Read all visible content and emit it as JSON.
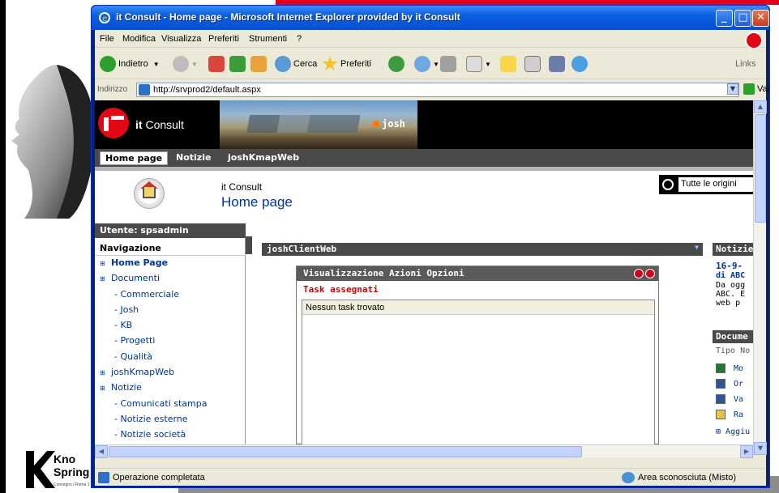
{
  "window": {
    "title": "it Consult - Home page - Microsoft Internet Explorer provided by it Consult",
    "controls": {
      "minimize": "_",
      "maximize": "□",
      "close": "✕"
    }
  },
  "menubar": [
    "File",
    "Modifica",
    "Visualizza",
    "Preferiti",
    "Strumenti",
    "?"
  ],
  "toolbar": {
    "back": "Indietro",
    "search": "Cerca",
    "favorites": "Preferiti",
    "links": "Links"
  },
  "address": {
    "label": "Indirizzo",
    "url": "http://srvprod2/default.aspx",
    "go": "Vai"
  },
  "site": {
    "brand_it": "it",
    "brand_rest": " Consult",
    "banner_label": "josh",
    "nav": [
      "Home page",
      "Notizie",
      "joshKmapWeb"
    ],
    "org": "it Consult",
    "title": "Home page",
    "search_value": "Tutte le origini"
  },
  "left": {
    "user": "Utente: spsadmin",
    "nav_title": "Navigazione",
    "items": [
      {
        "label": "Home Page",
        "level": 0,
        "bold": true
      },
      {
        "label": "Documenti",
        "level": 0
      },
      {
        "label": "- Commerciale",
        "level": 1
      },
      {
        "label": "- Josh",
        "level": 1
      },
      {
        "label": "- KB",
        "level": 1
      },
      {
        "label": "- Progetti",
        "level": 1
      },
      {
        "label": "- Qualità",
        "level": 1
      },
      {
        "label": "joshKmapWeb",
        "level": 0
      },
      {
        "label": "Notizie",
        "level": 0
      },
      {
        "label": "- Comunicati stampa",
        "level": 1
      },
      {
        "label": "- Notizie esterne",
        "level": 1
      },
      {
        "label": "- Notizie società",
        "level": 1
      }
    ]
  },
  "center": {
    "webpart_title": "joshClientWeb",
    "task_menu": "Visualizzazione  Azioni  Opzioni",
    "task_title": "Task assegnati",
    "task_empty": "Nessun task trovato"
  },
  "right": {
    "news_head": "Notizie",
    "news_date": "16-9-",
    "news_title": "di ABC",
    "news_lines": [
      "Da ogg",
      "ABC. E",
      "web p"
    ],
    "docs_head": "Docume",
    "docs_cols": "Tipo No",
    "docs": [
      {
        "name": "Mo",
        "icon": "excel-icon",
        "color": "#1d7a2f"
      },
      {
        "name": "Or",
        "icon": "word-icon",
        "color": "#2b5797"
      },
      {
        "name": "Va",
        "icon": "word-icon",
        "color": "#2b5797"
      },
      {
        "name": "Ra",
        "icon": "folder-icon",
        "color": "#e8c24a"
      }
    ],
    "add_link": "Aggiu"
  },
  "status": {
    "left": "Operazione completata",
    "zone": "Area sconosciuta (Misto)"
  },
  "slide": {
    "logo_line1": "Kno",
    "logo_line2": "Spring 2006",
    "logo_small": "Convegno / Roma 1 aprile 2006"
  },
  "colors": {
    "accent_red": "#e30613",
    "xp_blue": "#0a5fe0",
    "header_gray": "#4a4a4a",
    "link_blue": "#003399"
  }
}
